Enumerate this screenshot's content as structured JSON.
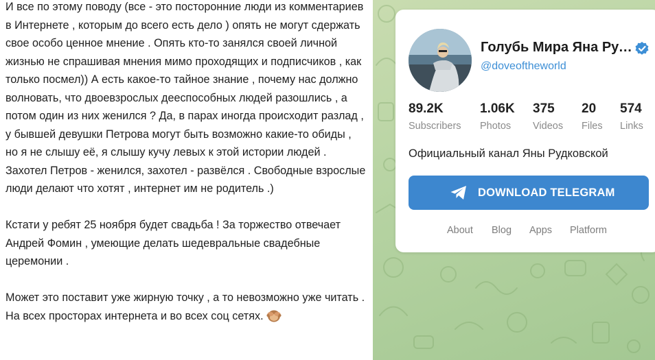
{
  "post": {
    "paragraphs": [
      "И все по этому поводу (все - это посторонние люди из комментариев в Интернете , которым до всего есть дело ) опять не могут сдержать свое особо ценное мнение . Опять кто-то занялся своей личной жизнью не спрашивая мнения мимо проходящих и подписчиков , как только посмел)) А есть какое-то тайное знание , почему нас должно волновать, что двоевзрослых дееспособных людей разошлись , а потом один из них женился ? Да, в парах иногда происходит разлад , у бывшей девушки Петрова могут быть возможно какие-то обиды , но я не слышу её, я слышу кучу левых к этой истории людей . Захотел Петров - женился, захотел - развёлся . Свободные взрослые люди делают что хотят , интернет им не родитель .)",
      "Кстати у ребят 25 ноября будет свадьба ! За торжество отвечает Андрей Фомин , умеющие делать шедевральные свадебные церемонии .",
      "Может это поставит уже жирную точку , а то невозможно уже читать . На всех просторах интернета и во всех соц сетях."
    ],
    "end_emoji": "see-no-evil-monkey-icon"
  },
  "channel": {
    "title": "Голубь Мира Яна Рудковская",
    "handle": "@doveoftheworld",
    "verified_icon": "verified-badge-icon",
    "stats": [
      {
        "value": "89.2K",
        "label": "Subscribers"
      },
      {
        "value": "1.06K",
        "label": "Photos"
      },
      {
        "value": "375",
        "label": "Videos"
      },
      {
        "value": "20",
        "label": "Files"
      },
      {
        "value": "574",
        "label": "Links"
      }
    ],
    "description": "Официальный канал Яны Рудковской",
    "download_label": "DOWNLOAD TELEGRAM",
    "footer_links": [
      "About",
      "Blog",
      "Apps",
      "Platform"
    ]
  },
  "colors": {
    "accent": "#3d87cf",
    "link": "#3d8fd6",
    "background_pattern": "#b6d3a2"
  }
}
